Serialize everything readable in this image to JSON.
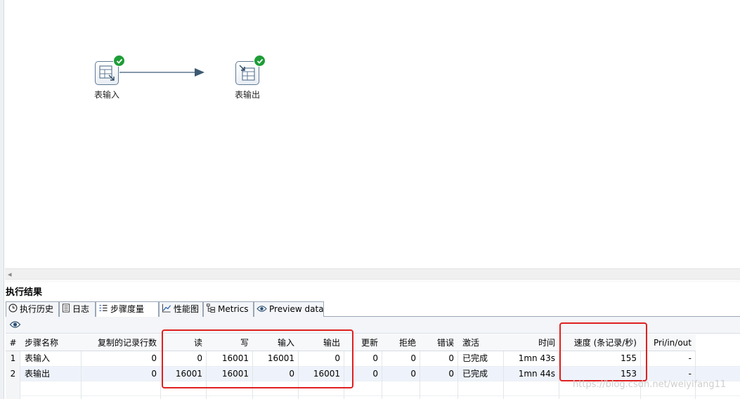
{
  "canvas": {
    "steps": [
      {
        "label": "表输入",
        "status": "ok"
      },
      {
        "label": "表输出",
        "status": "ok"
      }
    ]
  },
  "results": {
    "title": "执行结果",
    "tabs": [
      {
        "label": "执行历史",
        "icon": "clock-icon"
      },
      {
        "label": "日志",
        "icon": "log-icon"
      },
      {
        "label": "步骤度量",
        "icon": "metrics-list-icon",
        "active": true
      },
      {
        "label": "性能图",
        "icon": "chart-icon"
      },
      {
        "label": "Metrics",
        "icon": "tree-icon"
      },
      {
        "label": "Preview data",
        "icon": "eye-icon"
      }
    ],
    "table": {
      "columns": [
        "#",
        "步骤名称",
        "复制的记录行数",
        "读",
        "写",
        "输入",
        "输出",
        "更新",
        "拒绝",
        "错误",
        "激活",
        "时间",
        "速度 (条记录/秒)",
        "Pri/in/out"
      ],
      "rows": [
        [
          "1",
          "表输入",
          "0",
          "0",
          "16001",
          "16001",
          "0",
          "0",
          "0",
          "0",
          "已完成",
          "1mn 43s",
          "155",
          "-"
        ],
        [
          "2",
          "表输出",
          "0",
          "16001",
          "16001",
          "0",
          "16001",
          "0",
          "0",
          "0",
          "已完成",
          "1mn 44s",
          "153",
          "-"
        ]
      ]
    }
  },
  "watermark": "https://blog.csdn.net/weiyifang11",
  "colors": {
    "accent_red": "#e02020",
    "ok_green": "#1e9d37",
    "selected_row": "#eef3fb"
  }
}
